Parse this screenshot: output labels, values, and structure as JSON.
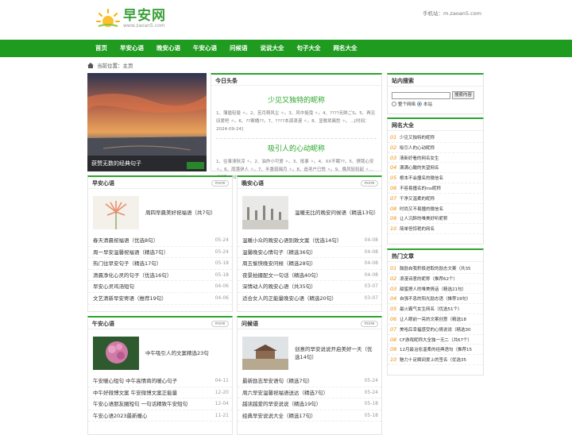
{
  "site": {
    "name": "早安网",
    "domain": "www.zaoan5.com",
    "mobile": "手机站：m.zaoan5.com"
  },
  "nav": [
    "首页",
    "早安心语",
    "晚安心语",
    "午安心语",
    "问候语",
    "说说大全",
    "句子大全",
    "网名大全"
  ],
  "breadcrumb": "当前位置：主页",
  "slider": {
    "caption": "获赞无数的经典句子"
  },
  "headline": {
    "title": "今日头条",
    "items": [
      {
        "title": "少见又独特的昵称",
        "summary": "1、薄眉轻蹙 ✧。2、苦月萌风尘 ✧。3、风中摇曳 ✧。4、????无眸ごS。5、再见旧爱吧 ✧。6、??案桶??。7、????本孤浪漫 ✧。8、显歌琐离愁 ✧。…[时间：2024-09-24]"
      },
      {
        "title": "吸引人的心动昵称",
        "summary": "1、往事清秋凉 ✧。2、油炸小可爱 ✧。3、抵事 ✧。4、XX不眠??。5、撩我心安 ✧。6、雨落伊人 ✧。7、半盏琉璃月 ✧。8、追寻户已悦 ✧。9、晚风轻轻起 ✧…[时间：2024-09-24]"
      }
    ]
  },
  "sections": {
    "morning": {
      "title": "早安心语",
      "more": "more",
      "featured": "周四早晨美好祝福语（共7句）",
      "items": [
        {
          "text": "春天清晨祝福语（优选8句）",
          "date": "05-24"
        },
        {
          "text": "周一早安温馨祝福语（精选7句）",
          "date": "05-24"
        },
        {
          "text": "热门往早安句子（精选17句）",
          "date": "05-18"
        },
        {
          "text": "清晨净化心灵的句子（优选16句）",
          "date": "05-18"
        },
        {
          "text": "早安心灵鸡汤短句",
          "date": "04-06"
        },
        {
          "text": "文艺清新早安寄语（推荐19句）",
          "date": "04-06"
        }
      ]
    },
    "evening": {
      "title": "晚安心语",
      "more": "more",
      "featured": "温暖无比的晚安问候语（精选13句）",
      "items": [
        {
          "text": "温暖小众的晚安心语别致文案（优选14句）",
          "date": "04-08"
        },
        {
          "text": "温馨晚安心情句子（精选36句）",
          "date": "04-08"
        },
        {
          "text": "周五愉快晚安问候（精选28句）",
          "date": "04-08"
        },
        {
          "text": "夜景拍摄配文一句话（精选40句）",
          "date": "04-08"
        },
        {
          "text": "深情动人的晚安心语（共35句）",
          "date": "03-07"
        },
        {
          "text": "适合女人的正能量晚安心语（精选20句）",
          "date": "03-07"
        }
      ]
    },
    "noon": {
      "title": "午安心语",
      "more": "more",
      "featured": "中午吸引人的文案精选23句",
      "items": [
        {
          "text": "午安暖心短句 中午高情商的暖心句子",
          "date": "04-11"
        },
        {
          "text": "中午好微博文案 午安微博文案正能量",
          "date": "12-20"
        },
        {
          "text": "午安心语朋友圈短句 一句话精致午安短句",
          "date": "12-04"
        },
        {
          "text": "午安心语2023最新暖心",
          "date": "11-21"
        }
      ]
    },
    "greetings": {
      "title": "问候语",
      "more": "more",
      "featured": "创意的早安说说开启美好一天（优选14句）",
      "items": [
        {
          "text": "最新励志早安语句（精选7句）",
          "date": "05-24"
        },
        {
          "text": "周六早安温馨祝福语送达（精选7句）",
          "date": "05-24"
        },
        {
          "text": "越读越爱的早安说说（精选19句）",
          "date": "05-18"
        },
        {
          "text": "经典早安说说大全（精选17句）",
          "date": "05-18"
        }
      ]
    }
  },
  "sidebar": {
    "search": {
      "title": "站内搜索",
      "button": "搜索内容",
      "option_all": "整个网络",
      "option_site": "本站"
    },
    "names": {
      "title": "网名大全",
      "items": [
        "少见又独特的昵称",
        "吸引人的心动昵称",
        "清新好看的网名女生",
        "满满心酸的失望网名",
        "根本不会撞名的微信名",
        "不容易撞名的ins昵称",
        "干净又温柔的昵称",
        "时尚又不易撞的微信名",
        "让人沉醉的唯美好听昵称",
        "简单但惊艳的网名"
      ]
    },
    "hot": {
      "title": "热门文章",
      "items": [
        "鼓励自我积极进取的励志文案（共35",
        "浪漫诗意的昵称（推荐62个）",
        "甜蜜撩人的唯美情话（精选21句）",
        "自强不息的阳光励志语（推荐19句）",
        "最火霸气女生网名（优选51个）",
        "让人眼前一亮的文案创意（精选18",
        "美哈后幸福感受的心情说说（精选30",
        "CF游戏昵称大全独一无二（共67个）",
        "12月最治愈温柔的经典语句（推荐15",
        "魅力十足瞬间爱上的签名（优选35"
      ]
    }
  },
  "colors": {
    "brand": "#1f9b1f",
    "accent": "#2aa52a",
    "rank_number": "#f08a00"
  }
}
